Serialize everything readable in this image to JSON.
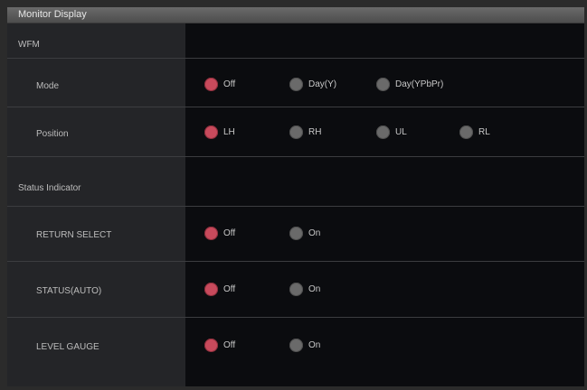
{
  "window": {
    "title": "Monitor Display"
  },
  "colors": {
    "selected": "#c84a5c",
    "unselected": "#6a6a6a"
  },
  "sections": {
    "wfm": {
      "label": "WFM",
      "mode": {
        "label": "Mode",
        "options": [
          "Off",
          "Day(Y)",
          "Day(YPbPr)"
        ],
        "selected": "Off"
      },
      "position": {
        "label": "Position",
        "options": [
          "LH",
          "RH",
          "UL",
          "RL"
        ],
        "selected": "LH"
      }
    },
    "status_indicator": {
      "label": "Status Indicator",
      "return_select": {
        "label": "RETURN SELECT",
        "options": [
          "Off",
          "On"
        ],
        "selected": "Off"
      },
      "status_auto": {
        "label": "STATUS(AUTO)",
        "options": [
          "Off",
          "On"
        ],
        "selected": "Off"
      },
      "level_gauge": {
        "label": "LEVEL GAUGE",
        "options": [
          "Off",
          "On"
        ],
        "selected": "Off"
      }
    }
  }
}
